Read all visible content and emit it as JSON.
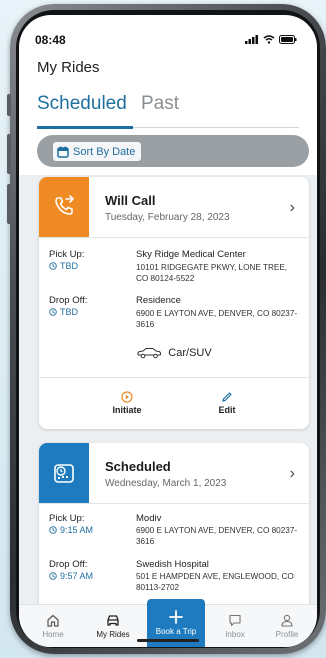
{
  "status": {
    "time": "08:48"
  },
  "header": {
    "title": "My Rides"
  },
  "tabs": [
    {
      "label": "Scheduled"
    },
    {
      "label": "Past"
    }
  ],
  "sort": {
    "label": "Sort By Date"
  },
  "rides": [
    {
      "title": "Will Call",
      "date": "Tuesday, February 28, 2023",
      "icon": "phone-forward-icon",
      "icon_bg": "#f08a24",
      "pickup": {
        "label": "Pick Up:",
        "time": "TBD",
        "place": "Sky Ridge Medical Center",
        "address": "10101 RIDGEGATE PKWY, LONE TREE, CO 80124-5522"
      },
      "dropoff": {
        "label": "Drop Off:",
        "time": "TBD",
        "place": "Residence",
        "address": "6900 E LAYTON AVE, DENVER, CO 80237-3616"
      },
      "vehicle": "Car/SUV",
      "actions": [
        {
          "label": "Initiate",
          "icon": "play-circle-icon"
        },
        {
          "label": "Edit",
          "icon": "pencil-icon"
        }
      ]
    },
    {
      "title": "Scheduled",
      "date": "Wednesday, March 1, 2023",
      "icon": "calendar-clock-icon",
      "icon_bg": "#1f7bbf",
      "pickup": {
        "label": "Pick Up:",
        "time": "9:15 AM",
        "place": "Modiv",
        "address": "6900 E LAYTON AVE, DENVER, CO 80237-3616"
      },
      "dropoff": {
        "label": "Drop Off:",
        "time": "9:57 AM",
        "place": "Swedish Hospital",
        "address": "501 E HAMPDEN AVE, ENGLEWOOD, CO 80113-2702"
      }
    }
  ],
  "nav": [
    {
      "label": "Home",
      "icon": "home-icon"
    },
    {
      "label": "My Rides",
      "icon": "car-icon"
    },
    {
      "label": "Book a Trip",
      "icon": "plus-icon"
    },
    {
      "label": "Inbox",
      "icon": "chat-icon"
    },
    {
      "label": "Profile",
      "icon": "person-icon"
    }
  ],
  "colors": {
    "accent": "#1f6f9e",
    "nav_active_bg": "#1f7bbf"
  }
}
